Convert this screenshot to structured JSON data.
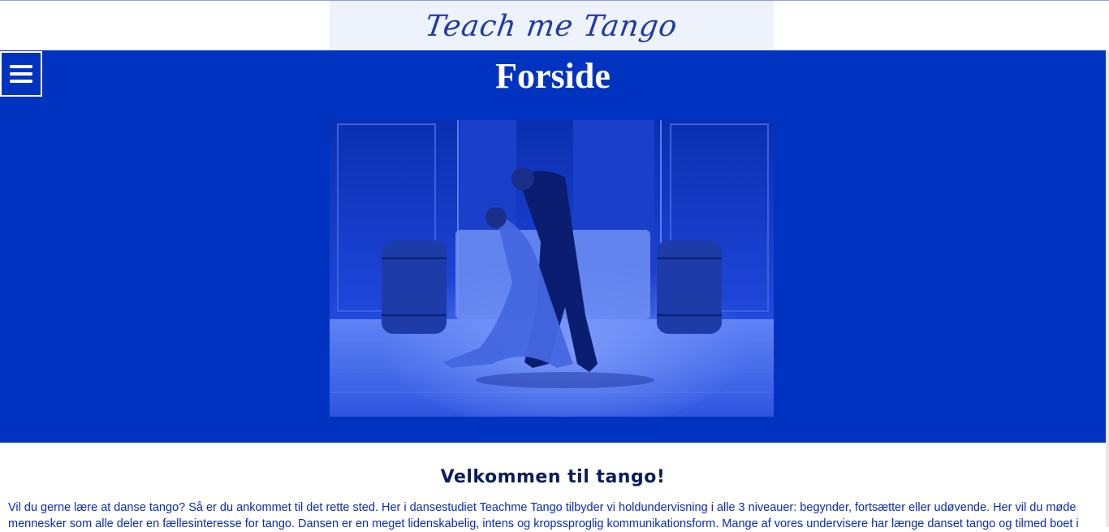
{
  "header": {
    "logo_text": "Teach me Tango"
  },
  "nav": {
    "menu_icon": "hamburger-menu-icon"
  },
  "hero": {
    "title": "Forside",
    "image_alt": "tango-dancers-image"
  },
  "content": {
    "heading": "Velkommen til tango!",
    "intro": "Vil du gerne lære at danse tango? Så er du ankommet til det rette sted. Her i dansestudiet Teachme Tango tilbyder vi holdundervisning i alle 3 niveauer: begynder, fortsætter eller udøvende. Her vil du møde mennesker som alle deler en fællesinteresse for tango. Dansen er en meget lidenskabelig, intens og kropssproglig kommunikationsform. Mange af vores undervisere har længe danset tango og tilmed boet i"
  },
  "colors": {
    "brand_blue": "#0133c1",
    "heading_navy": "#0a1d5c",
    "text_blue": "#0a2ab8"
  }
}
